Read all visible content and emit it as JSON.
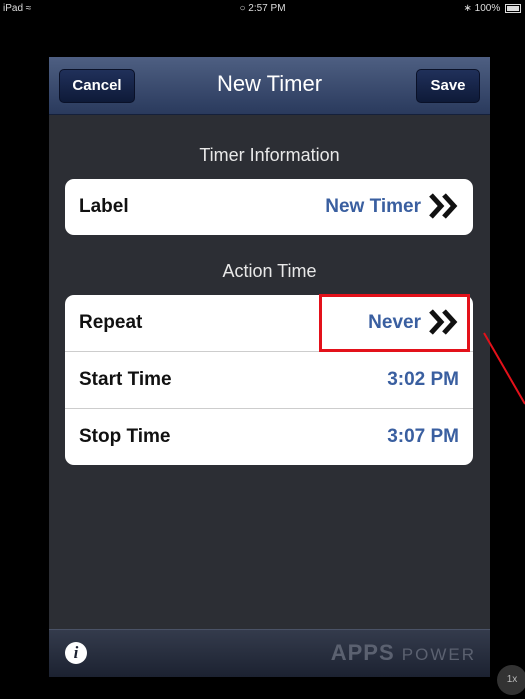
{
  "status_bar": {
    "device": "iPad",
    "time": "2:57 PM",
    "battery": "100%"
  },
  "navbar": {
    "cancel_label": "Cancel",
    "title": "New Timer",
    "save_label": "Save"
  },
  "sections": {
    "timer_info": {
      "header": "Timer Information",
      "rows": [
        {
          "label": "Label",
          "value": "New Timer"
        }
      ]
    },
    "action_time": {
      "header": "Action Time",
      "rows": [
        {
          "label": "Repeat",
          "value": "Never"
        },
        {
          "label": "Start Time",
          "value": "3:02 PM"
        },
        {
          "label": "Stop Time",
          "value": "3:07 PM"
        }
      ]
    }
  },
  "toolbar": {
    "info_icon": "i",
    "logo_a": "APPS",
    "logo_b": "POWER"
  },
  "zoom_badge": "1x",
  "colors": {
    "accent_value": "#3a5fa0",
    "highlight": "#e3111a",
    "navbar": "#3b4b6e"
  }
}
